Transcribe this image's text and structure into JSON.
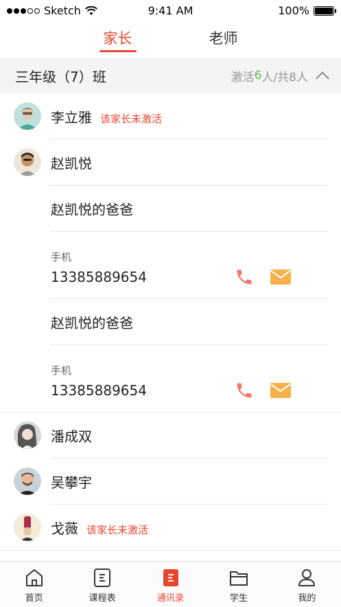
{
  "status_bar": {
    "carrier": "Sketch",
    "time": "9:41 AM",
    "battery": "100%"
  },
  "tabs": [
    {
      "label": "家长",
      "active": true
    },
    {
      "label": "老师",
      "active": false
    }
  ],
  "class_header": {
    "title": "三年级（7）班",
    "stat_prefix": "激活",
    "activated": "6",
    "stat_suffix": "人/共8人"
  },
  "contacts": [
    {
      "name": "李立雅",
      "badge": "该家长未激活"
    },
    {
      "name": "赵凯悦",
      "badge": ""
    },
    {
      "name": "潘成双",
      "badge": ""
    },
    {
      "name": "吴攀宇",
      "badge": ""
    },
    {
      "name": "戈薇",
      "badge": "该家长未激活"
    }
  ],
  "parents": [
    {
      "name": "赵凯悦的爸爸",
      "phone_label": "手机",
      "phone": "13385889654"
    },
    {
      "name": "赵凯悦的爸爸",
      "phone_label": "手机",
      "phone": "13385889654"
    }
  ],
  "tabbar": [
    {
      "label": "首页",
      "icon": "home-icon",
      "active": false
    },
    {
      "label": "课程表",
      "icon": "schedule-icon",
      "active": false
    },
    {
      "label": "通讯录",
      "icon": "contacts-icon",
      "active": true
    },
    {
      "label": "学生",
      "icon": "folder-icon",
      "active": false
    },
    {
      "label": "我的",
      "icon": "user-icon",
      "active": false
    }
  ],
  "colors": {
    "accent": "#e8452f",
    "active_count": "#5cba5e",
    "phone_icon": "#f07a6a",
    "mail_icon": "#f5b04a"
  }
}
